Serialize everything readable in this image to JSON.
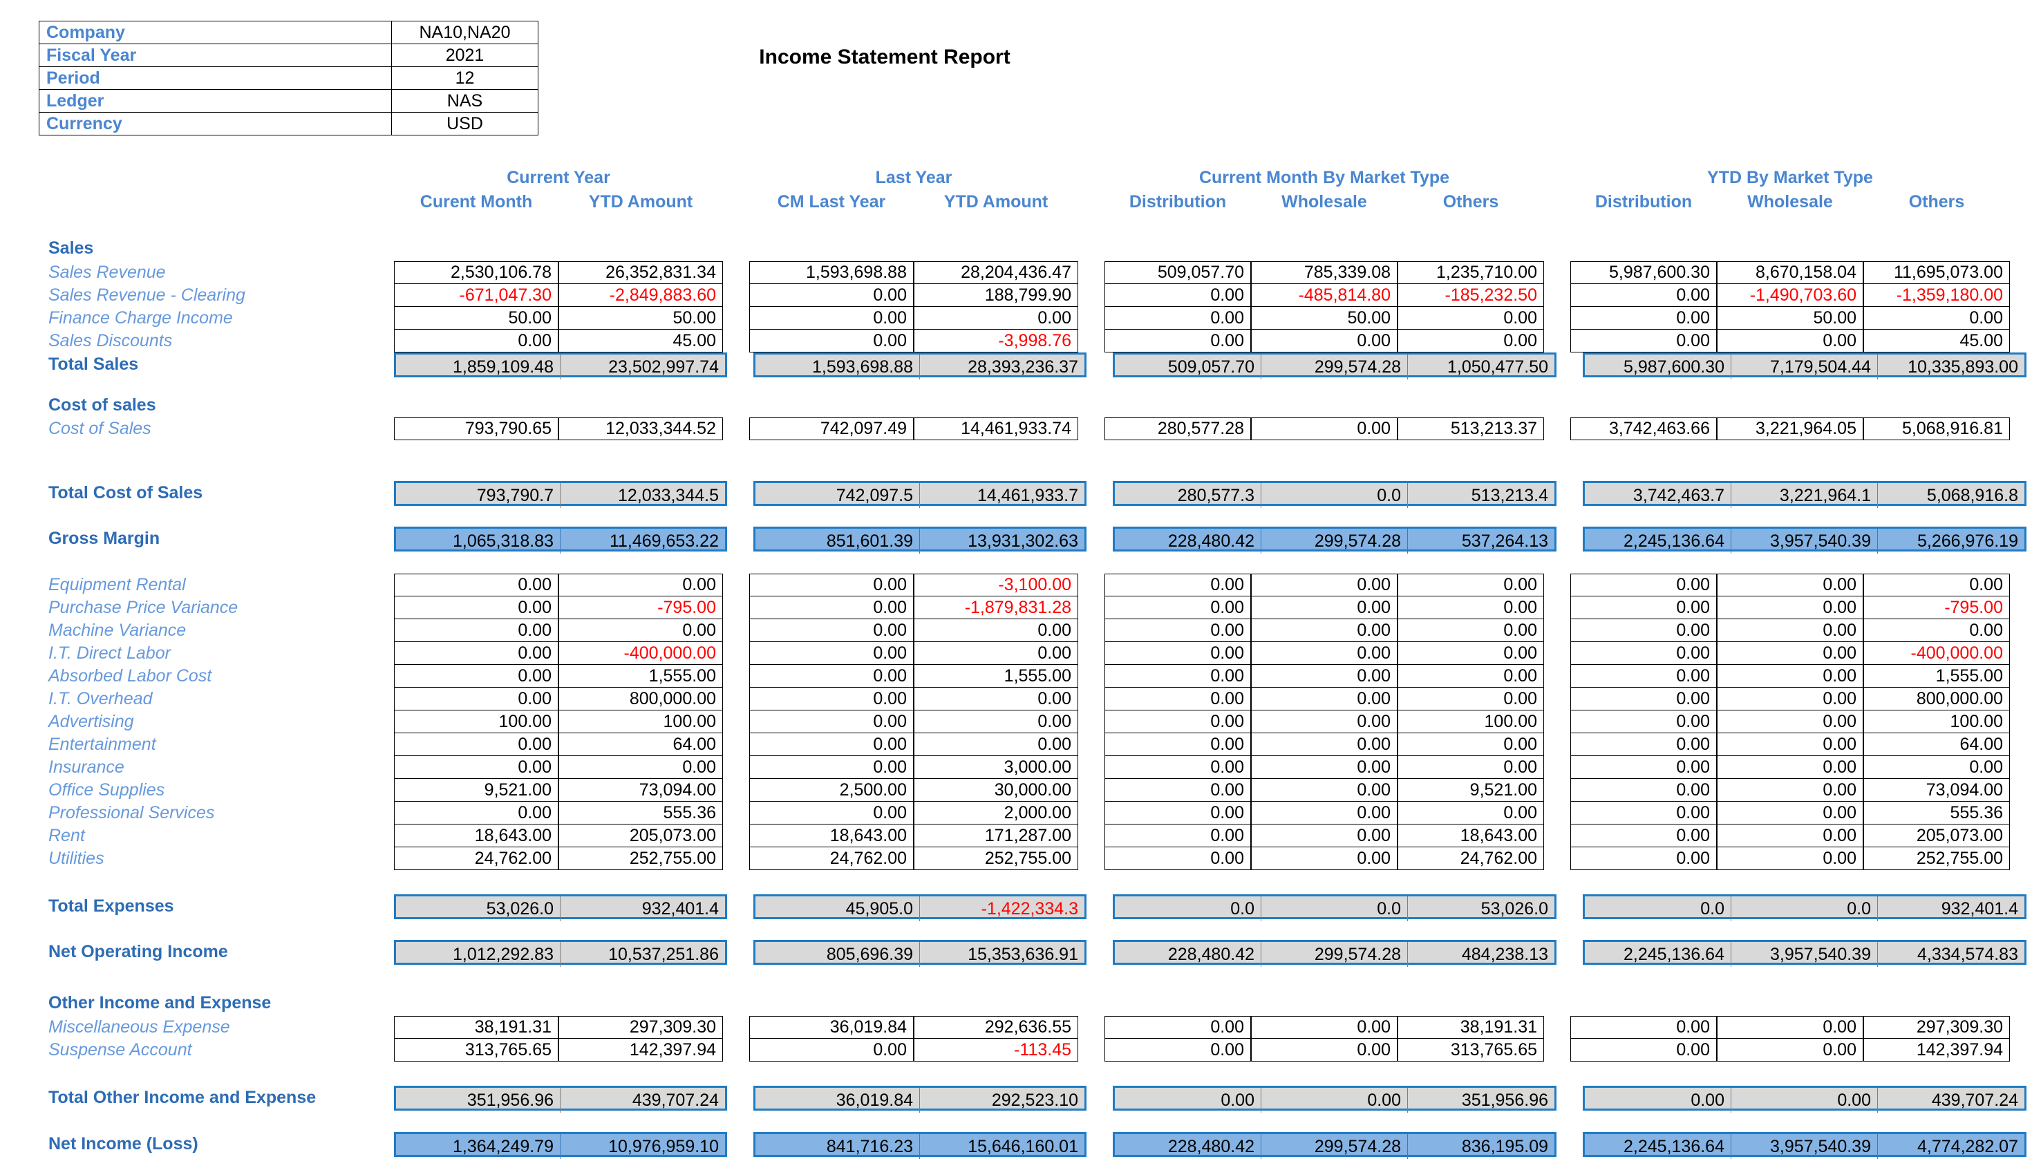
{
  "report": {
    "title": "Income Statement Report"
  },
  "parameters": [
    {
      "label": "Company",
      "value": "NA10,NA20"
    },
    {
      "label": "Fiscal Year",
      "value": "2021"
    },
    {
      "label": "Period",
      "value": "12"
    },
    {
      "label": "Ledger",
      "value": "NAS"
    },
    {
      "label": "Currency",
      "value": "USD"
    }
  ],
  "column_groups": [
    {
      "label": "Current Year",
      "columns": [
        "Curent Month",
        "YTD Amount"
      ]
    },
    {
      "label": "Last Year",
      "columns": [
        "CM Last Year",
        "YTD Amount"
      ]
    },
    {
      "label": "Current Month By Market Type",
      "columns": [
        "Distribution",
        "Wholesale",
        "Others"
      ]
    },
    {
      "label": "YTD By Market Type",
      "columns": [
        "Distribution",
        "Wholesale",
        "Others"
      ]
    }
  ],
  "colors": {
    "header_blue": "#4a86d0",
    "label_blue": "#2d6cb5",
    "item_blue": "#6699dd",
    "negative_red": "#ff0000",
    "subtotal_fill": "#d9d9d9",
    "total_fill": "#84b3e4",
    "outline_blue": "#1f7cc4"
  },
  "sections": [
    {
      "name": "Sales",
      "heading": "Sales"
    },
    {
      "name": "Cost of sales",
      "heading": "Cost of sales"
    },
    {
      "name": "Other Income and Expense",
      "heading": "Other Income and Expense"
    }
  ],
  "rows": [
    {
      "label": "Sales Revenue",
      "style": "item",
      "values": [
        "2,530,106.78",
        "26,352,831.34",
        "1,593,698.88",
        "28,204,436.47",
        "509,057.70",
        "785,339.08",
        "1,235,710.00",
        "5,987,600.30",
        "8,670,158.04",
        "11,695,073.00"
      ]
    },
    {
      "label": "Sales Revenue - Clearing",
      "style": "item",
      "values": [
        "-671,047.30",
        "-2,849,883.60",
        "0.00",
        "188,799.90",
        "0.00",
        "-485,814.80",
        "-185,232.50",
        "0.00",
        "-1,490,703.60",
        "-1,359,180.00"
      ]
    },
    {
      "label": "Finance Charge Income",
      "style": "item",
      "values": [
        "50.00",
        "50.00",
        "0.00",
        "0.00",
        "0.00",
        "50.00",
        "0.00",
        "0.00",
        "50.00",
        "0.00"
      ]
    },
    {
      "label": "Sales Discounts",
      "style": "item",
      "values": [
        "0.00",
        "45.00",
        "0.00",
        "-3,998.76",
        "0.00",
        "0.00",
        "0.00",
        "0.00",
        "0.00",
        "45.00"
      ]
    },
    {
      "label": "Total Sales",
      "style": "subtotal",
      "values": [
        "1,859,109.48",
        "23,502,997.74",
        "1,593,698.88",
        "28,393,236.37",
        "509,057.70",
        "299,574.28",
        "1,050,477.50",
        "5,987,600.30",
        "7,179,504.44",
        "10,335,893.00"
      ]
    },
    {
      "label": "Cost of Sales",
      "style": "item",
      "values": [
        "793,790.65",
        "12,033,344.52",
        "742,097.49",
        "14,461,933.74",
        "280,577.28",
        "0.00",
        "513,213.37",
        "3,742,463.66",
        "3,221,964.05",
        "5,068,916.81"
      ]
    },
    {
      "label": "Total Cost of Sales",
      "style": "subtotal",
      "values": [
        "793,790.7",
        "12,033,344.5",
        "742,097.5",
        "14,461,933.7",
        "280,577.3",
        "0.0",
        "513,213.4",
        "3,742,463.7",
        "3,221,964.1",
        "5,068,916.8"
      ]
    },
    {
      "label": "Gross Margin",
      "style": "total",
      "values": [
        "1,065,318.83",
        "11,469,653.22",
        "851,601.39",
        "13,931,302.63",
        "228,480.42",
        "299,574.28",
        "537,264.13",
        "2,245,136.64",
        "3,957,540.39",
        "5,266,976.19"
      ]
    },
    {
      "label": "Equipment Rental",
      "style": "item",
      "values": [
        "0.00",
        "0.00",
        "0.00",
        "-3,100.00",
        "0.00",
        "0.00",
        "0.00",
        "0.00",
        "0.00",
        "0.00"
      ]
    },
    {
      "label": "Purchase Price Variance",
      "style": "item",
      "values": [
        "0.00",
        "-795.00",
        "0.00",
        "-1,879,831.28",
        "0.00",
        "0.00",
        "0.00",
        "0.00",
        "0.00",
        "-795.00"
      ]
    },
    {
      "label": "Machine Variance",
      "style": "item",
      "values": [
        "0.00",
        "0.00",
        "0.00",
        "0.00",
        "0.00",
        "0.00",
        "0.00",
        "0.00",
        "0.00",
        "0.00"
      ]
    },
    {
      "label": "I.T. Direct Labor",
      "style": "item",
      "values": [
        "0.00",
        "-400,000.00",
        "0.00",
        "0.00",
        "0.00",
        "0.00",
        "0.00",
        "0.00",
        "0.00",
        "-400,000.00"
      ]
    },
    {
      "label": "Absorbed Labor Cost",
      "style": "item",
      "values": [
        "0.00",
        "1,555.00",
        "0.00",
        "1,555.00",
        "0.00",
        "0.00",
        "0.00",
        "0.00",
        "0.00",
        "1,555.00"
      ]
    },
    {
      "label": "I.T. Overhead",
      "style": "item",
      "values": [
        "0.00",
        "800,000.00",
        "0.00",
        "0.00",
        "0.00",
        "0.00",
        "0.00",
        "0.00",
        "0.00",
        "800,000.00"
      ]
    },
    {
      "label": "Advertising",
      "style": "item",
      "values": [
        "100.00",
        "100.00",
        "0.00",
        "0.00",
        "0.00",
        "0.00",
        "100.00",
        "0.00",
        "0.00",
        "100.00"
      ]
    },
    {
      "label": "Entertainment",
      "style": "item",
      "values": [
        "0.00",
        "64.00",
        "0.00",
        "0.00",
        "0.00",
        "0.00",
        "0.00",
        "0.00",
        "0.00",
        "64.00"
      ]
    },
    {
      "label": "Insurance",
      "style": "item",
      "values": [
        "0.00",
        "0.00",
        "0.00",
        "3,000.00",
        "0.00",
        "0.00",
        "0.00",
        "0.00",
        "0.00",
        "0.00"
      ]
    },
    {
      "label": "Office Supplies",
      "style": "item",
      "values": [
        "9,521.00",
        "73,094.00",
        "2,500.00",
        "30,000.00",
        "0.00",
        "0.00",
        "9,521.00",
        "0.00",
        "0.00",
        "73,094.00"
      ]
    },
    {
      "label": "Professional Services",
      "style": "item",
      "values": [
        "0.00",
        "555.36",
        "0.00",
        "2,000.00",
        "0.00",
        "0.00",
        "0.00",
        "0.00",
        "0.00",
        "555.36"
      ]
    },
    {
      "label": "Rent",
      "style": "item",
      "values": [
        "18,643.00",
        "205,073.00",
        "18,643.00",
        "171,287.00",
        "0.00",
        "0.00",
        "18,643.00",
        "0.00",
        "0.00",
        "205,073.00"
      ]
    },
    {
      "label": "Utilities",
      "style": "item",
      "values": [
        "24,762.00",
        "252,755.00",
        "24,762.00",
        "252,755.00",
        "0.00",
        "0.00",
        "24,762.00",
        "0.00",
        "0.00",
        "252,755.00"
      ]
    },
    {
      "label": "Total Expenses",
      "style": "subtotal",
      "values": [
        "53,026.0",
        "932,401.4",
        "45,905.0",
        "-1,422,334.3",
        "0.0",
        "0.0",
        "53,026.0",
        "0.0",
        "0.0",
        "932,401.4"
      ]
    },
    {
      "label": "Net Operating Income",
      "style": "subtotal",
      "values": [
        "1,012,292.83",
        "10,537,251.86",
        "805,696.39",
        "15,353,636.91",
        "228,480.42",
        "299,574.28",
        "484,238.13",
        "2,245,136.64",
        "3,957,540.39",
        "4,334,574.83"
      ]
    },
    {
      "label": "Miscellaneous Expense",
      "style": "item",
      "values": [
        "38,191.31",
        "297,309.30",
        "36,019.84",
        "292,636.55",
        "0.00",
        "0.00",
        "38,191.31",
        "0.00",
        "0.00",
        "297,309.30"
      ]
    },
    {
      "label": "Suspense Account",
      "style": "item",
      "values": [
        "313,765.65",
        "142,397.94",
        "0.00",
        "-113.45",
        "0.00",
        "0.00",
        "313,765.65",
        "0.00",
        "0.00",
        "142,397.94"
      ]
    },
    {
      "label": "Total Other Income and Expense",
      "style": "subtotal",
      "values": [
        "351,956.96",
        "439,707.24",
        "36,019.84",
        "292,523.10",
        "0.00",
        "0.00",
        "351,956.96",
        "0.00",
        "0.00",
        "439,707.24"
      ]
    },
    {
      "label": "Net Income (Loss)",
      "style": "total",
      "values": [
        "1,364,249.79",
        "10,976,959.10",
        "841,716.23",
        "15,646,160.01",
        "228,480.42",
        "299,574.28",
        "836,195.09",
        "2,245,136.64",
        "3,957,540.39",
        "4,774,282.07"
      ]
    }
  ]
}
